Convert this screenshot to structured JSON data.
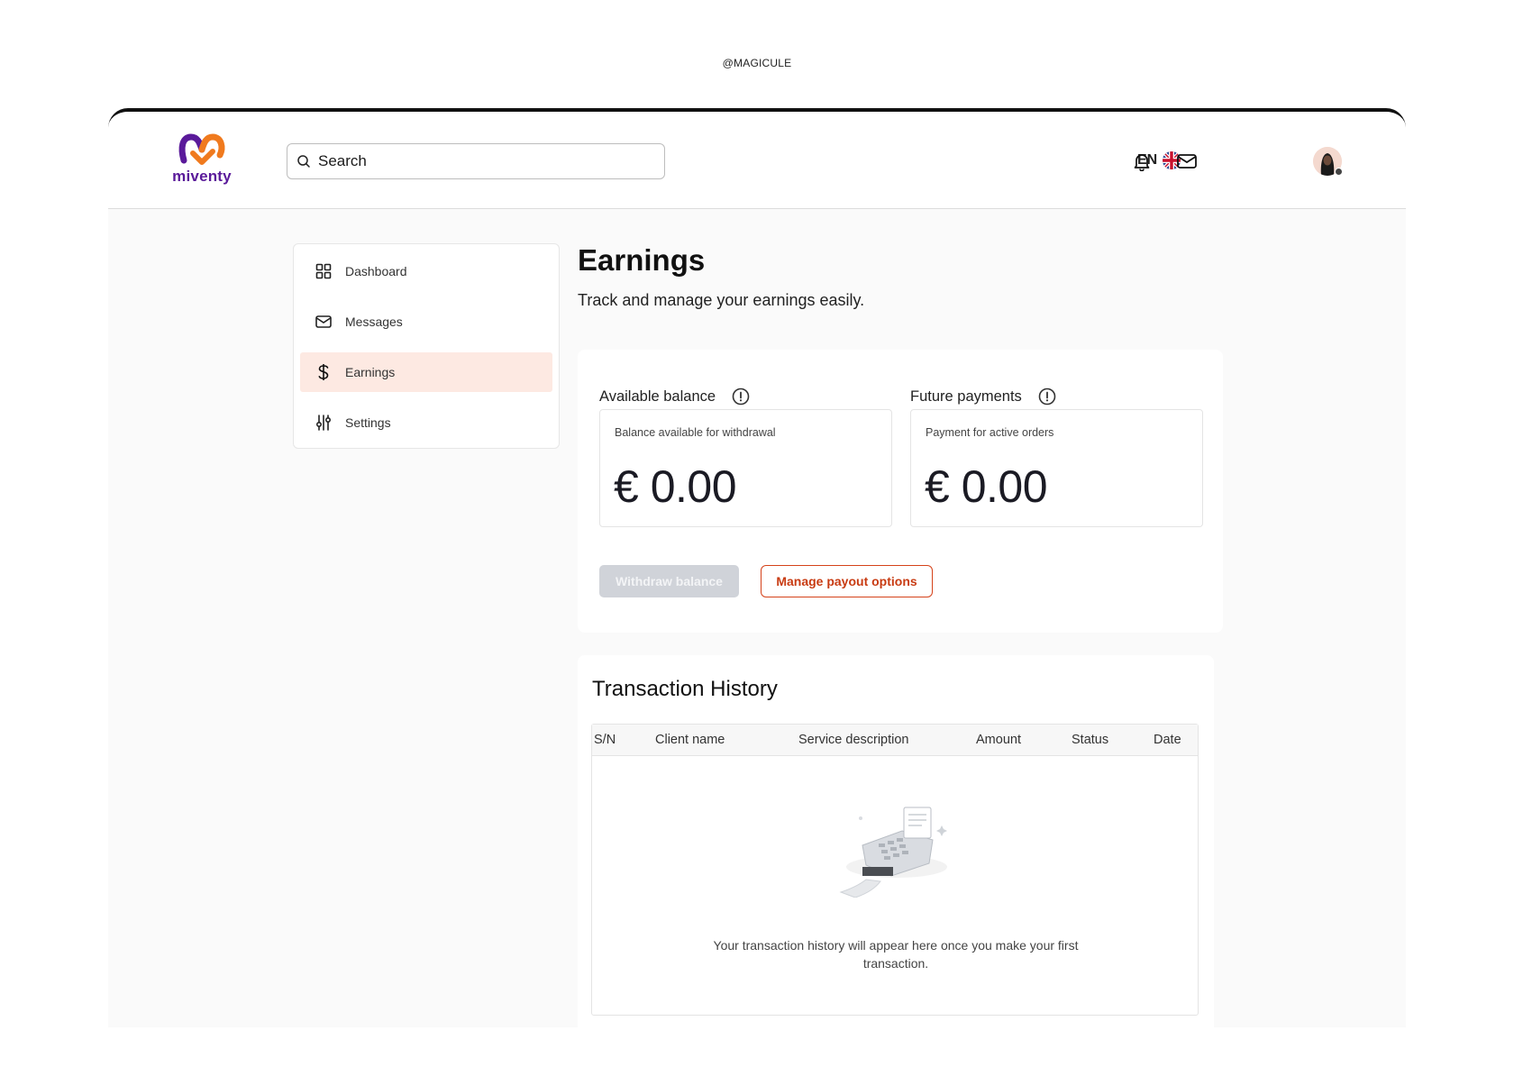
{
  "watermark": "@MAGICULE",
  "header": {
    "logo_text": "miventy",
    "search_placeholder": "Search",
    "language": "EN",
    "colors": {
      "brand_purple": "#5a1a9a",
      "brand_orange": "#f07a1e"
    }
  },
  "sidebar": {
    "items": [
      {
        "label": "Dashboard",
        "icon": "grid-icon"
      },
      {
        "label": "Messages",
        "icon": "envelope-icon"
      },
      {
        "label": "Earnings",
        "icon": "dollar-icon",
        "active": true
      },
      {
        "label": "Settings",
        "icon": "sliders-icon"
      }
    ]
  },
  "page": {
    "title": "Earnings",
    "subtitle": "Track and manage your earnings easily."
  },
  "balance": {
    "available": {
      "label": "Available balance",
      "caption": "Balance available for withdrawal",
      "amount": "€ 0.00"
    },
    "future": {
      "label": "Future payments",
      "caption": "Payment for active orders",
      "amount": "€ 0.00"
    },
    "withdraw_label": "Withdraw balance",
    "manage_label": "Manage payout options",
    "colors": {
      "accent": "#d5421a",
      "active_bg": "#fde9e2"
    }
  },
  "transactions": {
    "title": "Transaction History",
    "columns": [
      "S/N",
      "Client name",
      "Service description",
      "Amount",
      "Status",
      "Date"
    ],
    "rows": [],
    "empty_text": "Your transaction history will appear here once you make your first transaction."
  }
}
